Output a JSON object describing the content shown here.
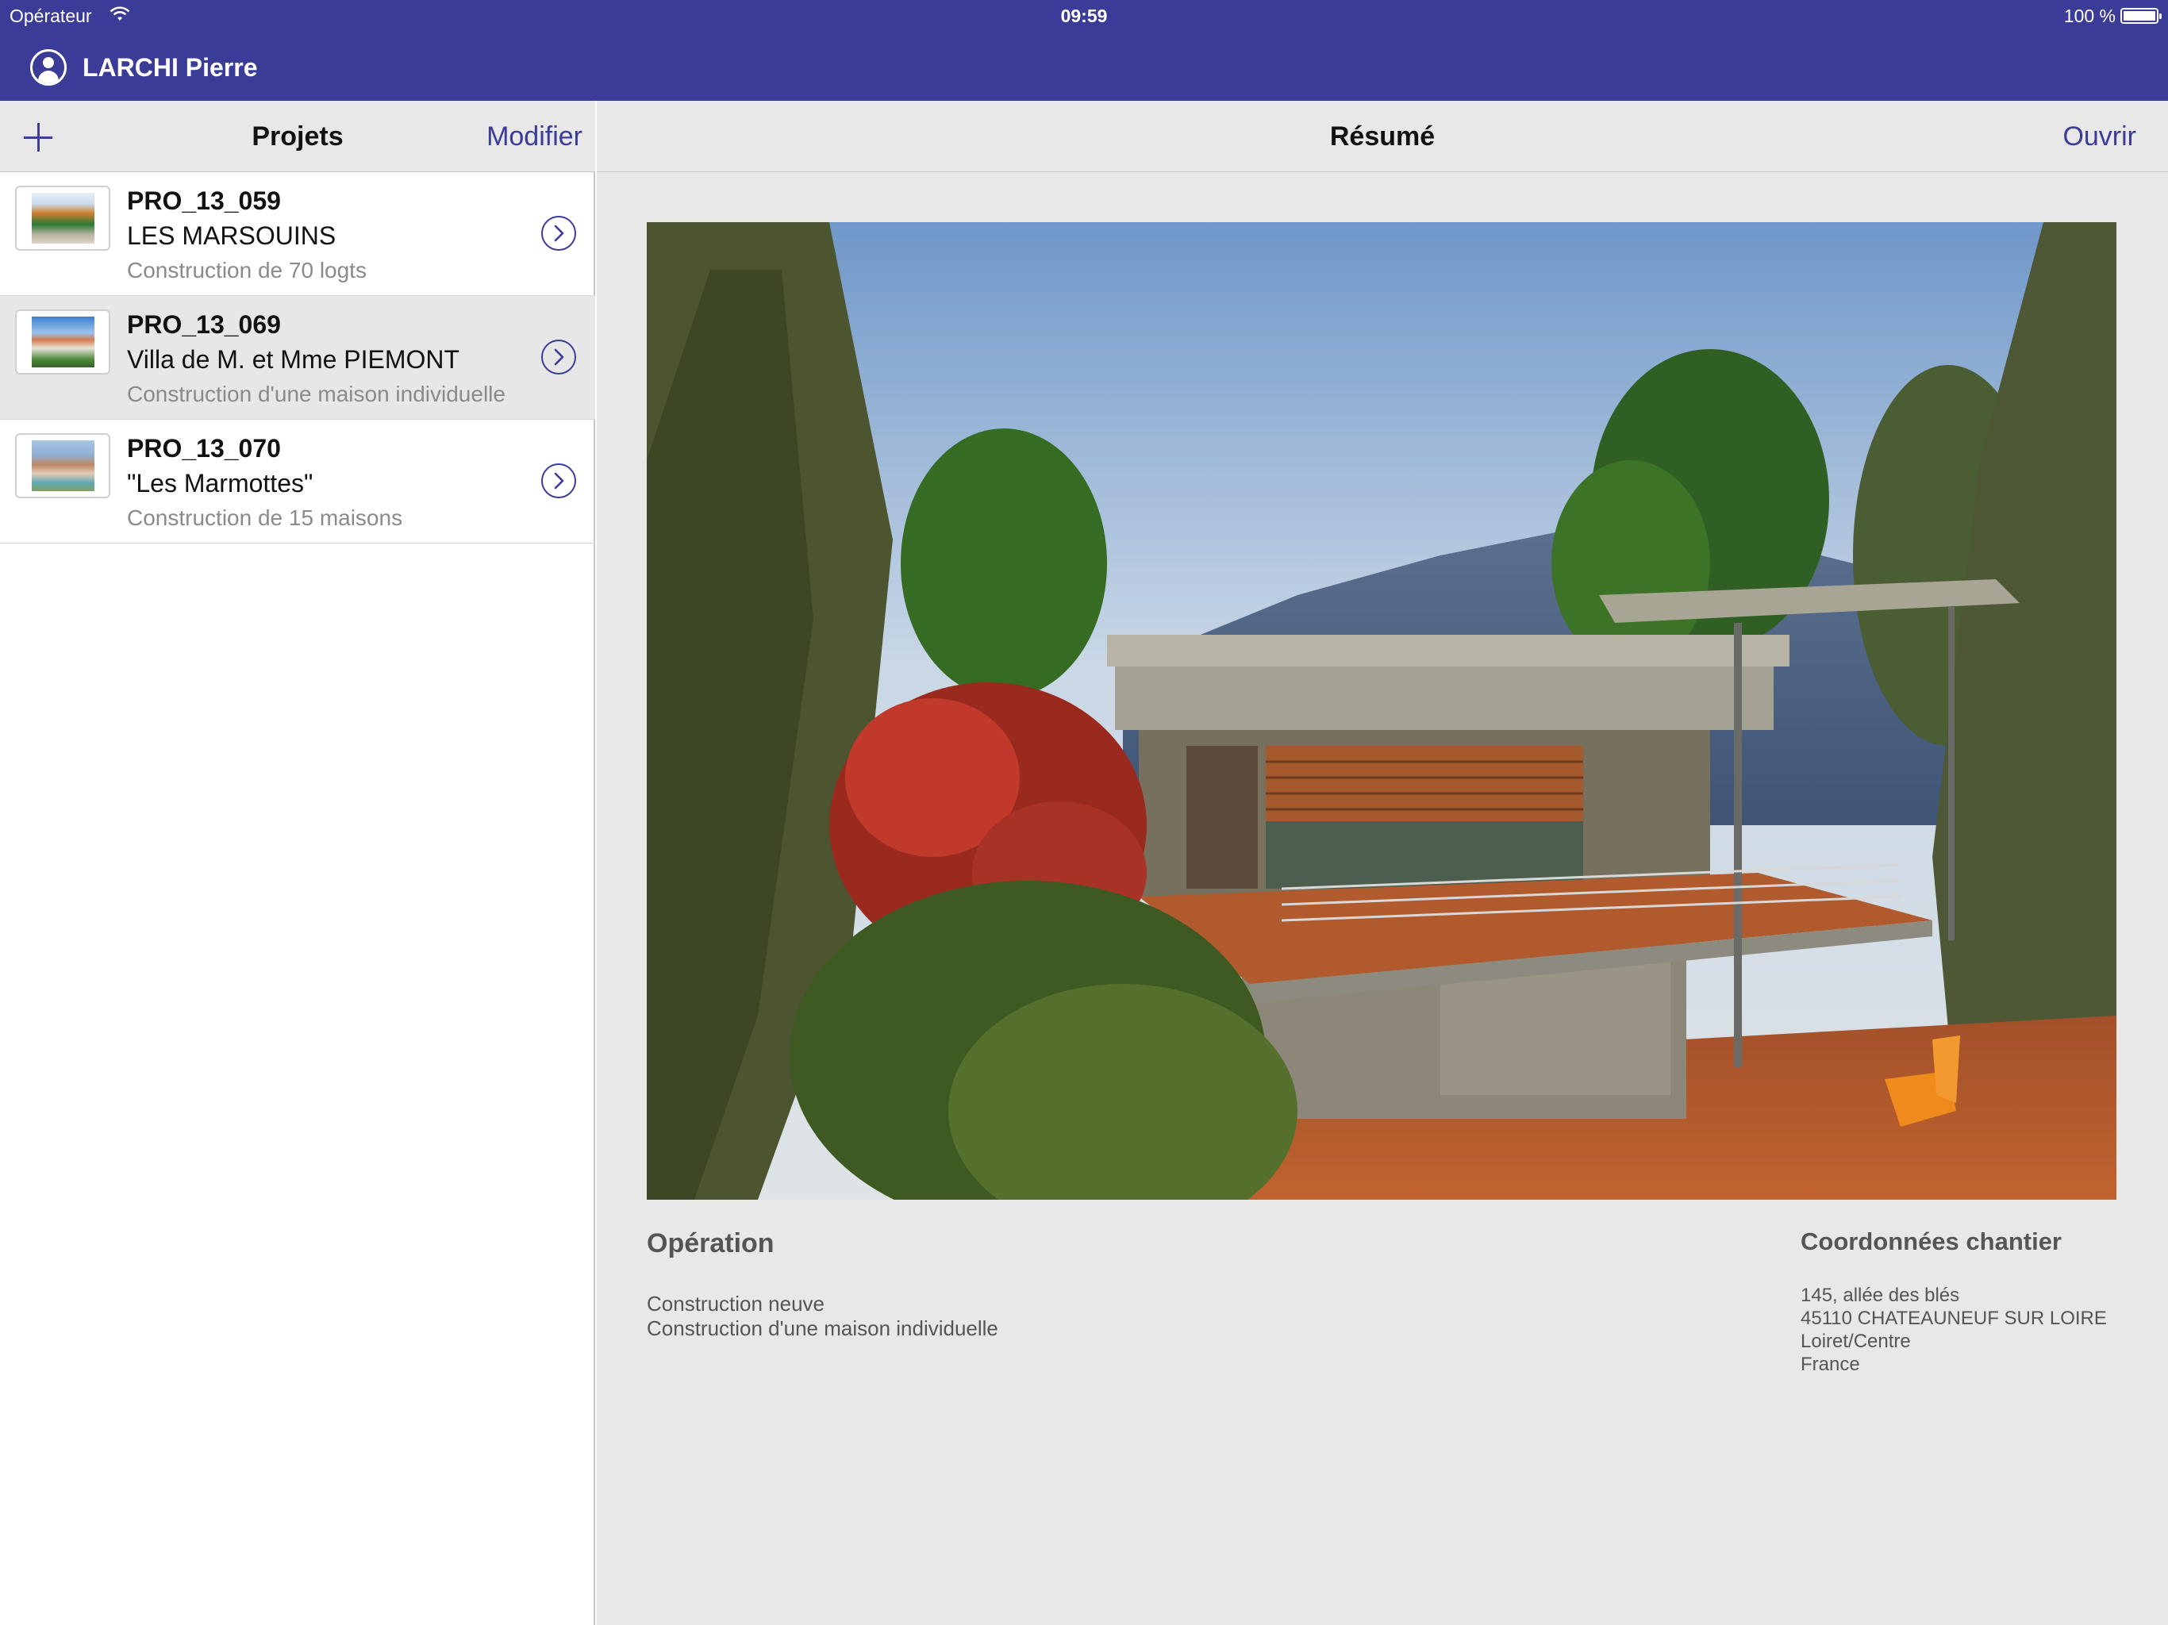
{
  "status_bar": {
    "carrier": "Opérateur",
    "time": "09:59",
    "battery": "100 %",
    "battery_level": 1.0
  },
  "header": {
    "user_name": "LARCHI Pierre",
    "icons": [
      "user-icon",
      "wifi-icon",
      "battery-icon"
    ]
  },
  "master": {
    "title": "Projets",
    "edit_label": "Modifier",
    "add_icon": "plus-icon",
    "projects": [
      {
        "code": "PRO_13_059",
        "name": "LES MARSOUINS",
        "description": "Construction de 70 logts",
        "selected": false
      },
      {
        "code": "PRO_13_069",
        "name": "Villa de M. et Mme PIEMONT",
        "description": "Construction d'une maison individuelle",
        "selected": true
      },
      {
        "code": "PRO_13_070",
        "name": " \"Les Marmottes\"",
        "description": "Construction de 15 maisons",
        "selected": false
      }
    ]
  },
  "detail": {
    "title": "Résumé",
    "open_label": "Ouvrir",
    "operation": {
      "title": "Opération",
      "lines": [
        "Construction neuve",
        "Construction d'une maison individuelle"
      ]
    },
    "site": {
      "title": "Coordonnées chantier",
      "lines": [
        "145, allée des blés",
        "45110 CHATEAUNEUF SUR LOIRE",
        "Loiret/Centre",
        "France"
      ]
    }
  },
  "colors": {
    "accent": "#3b3b98",
    "background": "#e8e8e8",
    "secondary_text": "#8a8a8a"
  }
}
